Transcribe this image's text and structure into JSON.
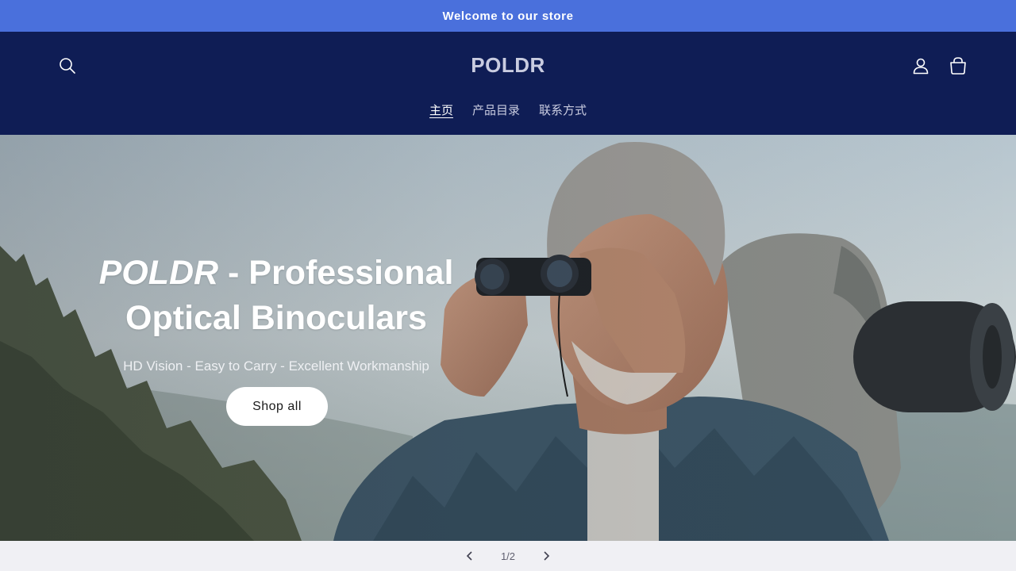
{
  "announcement": {
    "text": "Welcome to our store"
  },
  "header": {
    "logo": "POLDR",
    "nav": [
      {
        "label": "主页",
        "active": true
      },
      {
        "label": "产品目录",
        "active": false
      },
      {
        "label": "联系方式",
        "active": false
      }
    ],
    "icons": [
      "search-icon",
      "account-icon",
      "cart-icon"
    ]
  },
  "hero": {
    "title_brand": "POLDR",
    "title_rest": " - Professional Optical Binoculars",
    "subtitle": "HD Vision - Easy to Carry - Excellent Workmanship",
    "button_label": "Shop all"
  },
  "slider": {
    "counter": "1/2",
    "icons": [
      "chevron-left-icon",
      "chevron-right-icon"
    ]
  },
  "colors": {
    "announcement_bg": "#4a70dc",
    "header_bg": "#0f1d55",
    "nav_text": "#c9cce0"
  }
}
